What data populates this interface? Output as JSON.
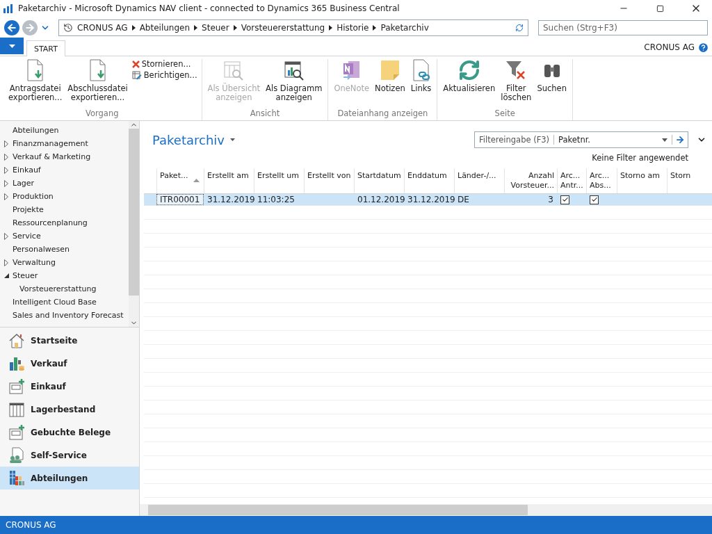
{
  "window": {
    "title": "Paketarchiv - Microsoft Dynamics NAV client - connected to Dynamics 365 Business Central"
  },
  "breadcrumb": [
    "CRONUS AG",
    "Abteilungen",
    "Steuer",
    "Vorsteuererstattung",
    "Historie",
    "Paketarchiv"
  ],
  "search": {
    "placeholder": "Suchen (Strg+F3)"
  },
  "ribbon_tabs": [
    {
      "label": "START",
      "selected": true
    }
  ],
  "company": "CRONUS AG",
  "ribbon_groups": [
    {
      "label": "Vorgang",
      "buttons": [
        {
          "kind": "large",
          "lines": [
            "Antragsdatei",
            "exportieren..."
          ],
          "disabled": false
        },
        {
          "kind": "large",
          "lines": [
            "Abschlussdatei",
            "exportieren..."
          ],
          "disabled": false
        },
        {
          "kind": "small",
          "lines": [
            "Stornieren..."
          ],
          "disabled": false
        },
        {
          "kind": "small",
          "lines": [
            "Berichtigen..."
          ],
          "disabled": false
        }
      ]
    },
    {
      "label": "Ansicht",
      "buttons": [
        {
          "kind": "large",
          "lines": [
            "Als Übersicht",
            "anzeigen"
          ],
          "disabled": true
        },
        {
          "kind": "large",
          "lines": [
            "Als Diagramm",
            "anzeigen"
          ],
          "disabled": false
        }
      ]
    },
    {
      "label": "Dateianhang anzeigen",
      "buttons": [
        {
          "kind": "large",
          "lines": [
            "OneNote"
          ],
          "disabled": true
        },
        {
          "kind": "large",
          "lines": [
            "Notizen"
          ],
          "disabled": false
        },
        {
          "kind": "large",
          "lines": [
            "Links"
          ],
          "disabled": false
        }
      ]
    },
    {
      "label": "Seite",
      "buttons": [
        {
          "kind": "large",
          "lines": [
            "Aktualisieren"
          ],
          "disabled": false
        },
        {
          "kind": "large",
          "lines": [
            "Filter",
            "löschen"
          ],
          "disabled": false
        },
        {
          "kind": "large",
          "lines": [
            "Suchen"
          ],
          "disabled": false
        }
      ]
    }
  ],
  "tree": [
    {
      "kind": "leaf",
      "label": "Abteilungen"
    },
    {
      "kind": "group",
      "label": "Finanzmanagement",
      "expanded": false
    },
    {
      "kind": "group",
      "label": "Verkauf & Marketing",
      "expanded": false
    },
    {
      "kind": "group",
      "label": "Einkauf",
      "expanded": false
    },
    {
      "kind": "group",
      "label": "Lager",
      "expanded": false
    },
    {
      "kind": "group",
      "label": "Produktion",
      "expanded": false
    },
    {
      "kind": "leaf",
      "label": "Projekte"
    },
    {
      "kind": "leaf",
      "label": "Ressourcenplanung"
    },
    {
      "kind": "group",
      "label": "Service",
      "expanded": false
    },
    {
      "kind": "leaf",
      "label": "Personalwesen"
    },
    {
      "kind": "group",
      "label": "Verwaltung",
      "expanded": false
    },
    {
      "kind": "group",
      "label": "Steuer",
      "expanded": true,
      "children": [
        {
          "kind": "leaf",
          "label": "Vorsteuererstattung"
        }
      ]
    },
    {
      "kind": "leaf",
      "label": "Intelligent Cloud Base"
    },
    {
      "kind": "leaf",
      "label": "Sales and Inventory Forecast"
    }
  ],
  "nav_buttons": [
    {
      "label": "Startseite",
      "selected": false
    },
    {
      "label": "Verkauf",
      "selected": false
    },
    {
      "label": "Einkauf",
      "selected": false
    },
    {
      "label": "Lagerbestand",
      "selected": false
    },
    {
      "label": "Gebuchte Belege",
      "selected": false
    },
    {
      "label": "Self-Service",
      "selected": false
    },
    {
      "label": "Abteilungen",
      "selected": true
    }
  ],
  "page": {
    "title": "Paketarchiv",
    "filter_label": "Filtereingabe (F3)",
    "filter_field": "Paketnr.",
    "filter_status": "Keine Filter angewendet"
  },
  "table": {
    "columns": [
      {
        "lines": [
          "Paket..."
        ],
        "sorted": true
      },
      {
        "lines": [
          "Erstellt am"
        ],
        "sorted": false
      },
      {
        "lines": [
          "Erstellt um"
        ],
        "sorted": false
      },
      {
        "lines": [
          "Erstellt von"
        ],
        "sorted": false
      },
      {
        "lines": [
          "Startdatum"
        ],
        "sorted": false
      },
      {
        "lines": [
          "Enddatum"
        ],
        "sorted": false
      },
      {
        "lines": [
          "Länder-/..."
        ],
        "sorted": false
      },
      {
        "lines": [
          "Anzahl",
          "Vorsteuer..."
        ],
        "sorted": false
      },
      {
        "lines": [
          "Arc...",
          "Antr..."
        ],
        "sorted": false
      },
      {
        "lines": [
          "Arc...",
          "Abs..."
        ],
        "sorted": false
      },
      {
        "lines": [
          "Storno am"
        ],
        "sorted": false
      },
      {
        "lines": [
          "Storn"
        ],
        "sorted": false
      }
    ],
    "rows": [
      {
        "selected": true,
        "cells": [
          {
            "kind": "text",
            "text": "ITR00001"
          },
          {
            "kind": "text",
            "text": "31.12.2019"
          },
          {
            "kind": "text",
            "text": "11:03:25"
          },
          {
            "kind": "empty"
          },
          {
            "kind": "text",
            "text": "01.12.2019"
          },
          {
            "kind": "text",
            "text": "31.12.2019"
          },
          {
            "kind": "text",
            "text": "DE"
          },
          {
            "kind": "number",
            "text": "3"
          },
          {
            "kind": "check",
            "checked": true
          },
          {
            "kind": "check",
            "checked": true
          },
          {
            "kind": "empty"
          },
          {
            "kind": "empty"
          }
        ]
      }
    ]
  },
  "status_bar": "CRONUS AG"
}
